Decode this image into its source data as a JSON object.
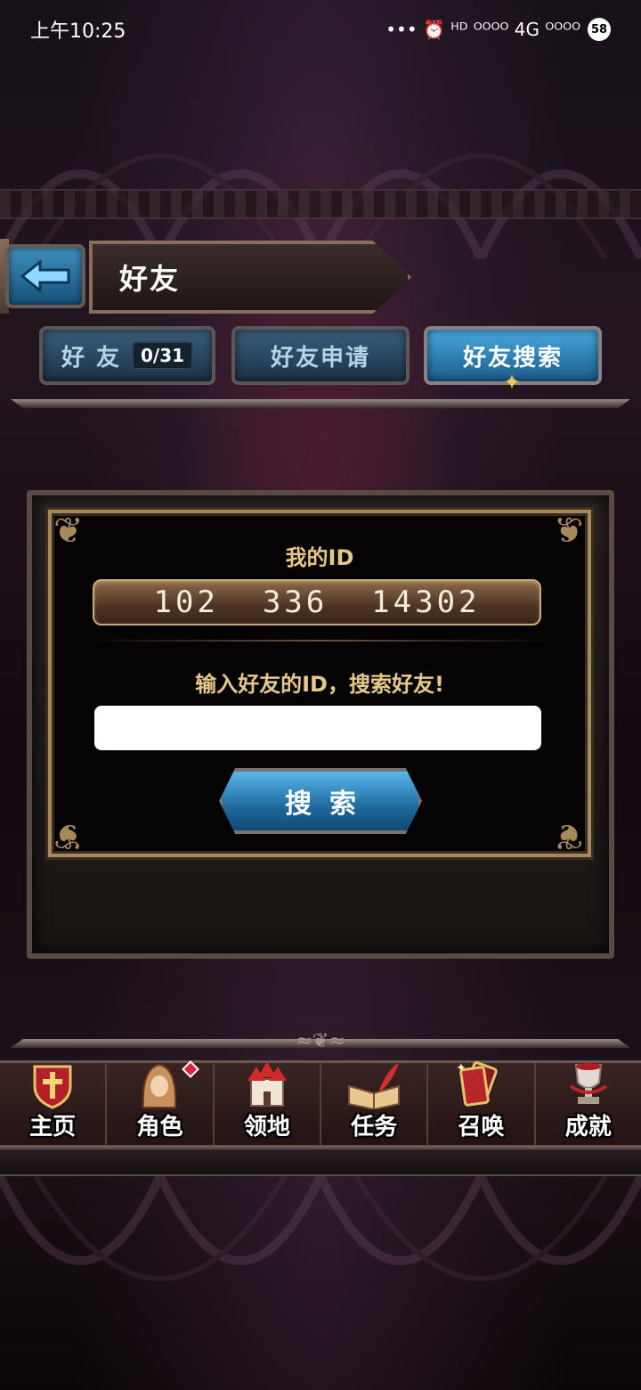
{
  "status_bar": {
    "time": "上午10:25",
    "indicators": "••• ⏰ ᴴᴰ ᴼᴼᴼᴼ 4G ᴼᴼᴼᴼ",
    "battery": "58"
  },
  "header": {
    "back_icon": "back-arrow-icon",
    "title": "好友"
  },
  "tabs": [
    {
      "label": "好 友",
      "count": "0/31",
      "active": false
    },
    {
      "label": "好友申请",
      "active": false
    },
    {
      "label": "好友搜索",
      "active": true
    }
  ],
  "search_panel": {
    "my_id_label": "我的ID",
    "my_id_value": "102  336  14302",
    "prompt": "输入好友的ID，搜索好友!",
    "input_value": "",
    "input_placeholder": "",
    "search_button": "搜索"
  },
  "bottom_nav": [
    {
      "label": "主页",
      "icon": "shield-cross-icon",
      "badge": false
    },
    {
      "label": "角色",
      "icon": "hooded-character-icon",
      "badge": true
    },
    {
      "label": "领地",
      "icon": "castle-icon",
      "badge": false
    },
    {
      "label": "任务",
      "icon": "quill-book-icon",
      "badge": false
    },
    {
      "label": "召唤",
      "icon": "summon-card-icon",
      "badge": false
    },
    {
      "label": "成就",
      "icon": "trophy-icon",
      "badge": false
    }
  ],
  "colors": {
    "accent_blue": "#2f86c0",
    "gold_text": "#e6c98a",
    "frame_gold": "#a78a5c",
    "badge_red": "#e0223a"
  }
}
